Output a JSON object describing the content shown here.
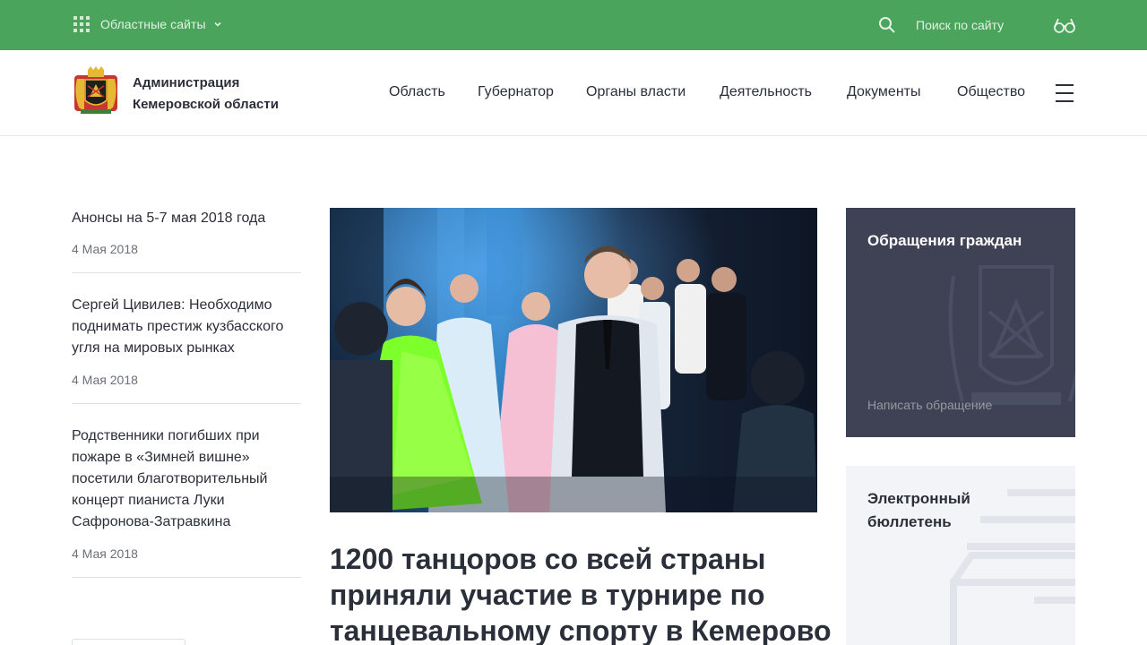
{
  "topbar": {
    "regional_sites": "Областные сайты",
    "search_label": "Поиск по сайту"
  },
  "header": {
    "brand_line1": "Администрация",
    "brand_line2": "Кемеровской области",
    "nav": [
      {
        "label": "Область"
      },
      {
        "label": "Губернатор"
      },
      {
        "label": "Органы власти"
      },
      {
        "label": "Деятельность"
      },
      {
        "label": "Документы"
      },
      {
        "label": "Общество"
      }
    ]
  },
  "news": [
    {
      "title": "Анонсы на 5-7 мая 2018 года",
      "date": "4 Мая 2018"
    },
    {
      "title": "Сергей Цивилев: Необходимо поднимать престиж кузбасского угля на мировых рынках",
      "date": "4 Мая 2018"
    },
    {
      "title": "Родственники погибших при пожаре в «Зимней вишне» посетили благотворительный концерт пианиста Луки Сафронова-Затравкина",
      "date": "4 Мая 2018"
    }
  ],
  "feature": {
    "title": "1200 танцоров со всей страны приняли участие в турнире по танцевальному спорту в Кемерово"
  },
  "appeal_card": {
    "title": "Обращения граждан",
    "link": "Написать обращение"
  },
  "bulletin_card": {
    "title": "Электронный бюллетень"
  },
  "colors": {
    "topbar": "#4aa45c",
    "appeal_bg": "#3e4254",
    "bulletin_bg": "#f2f4f7",
    "text": "#2b2f3a"
  }
}
